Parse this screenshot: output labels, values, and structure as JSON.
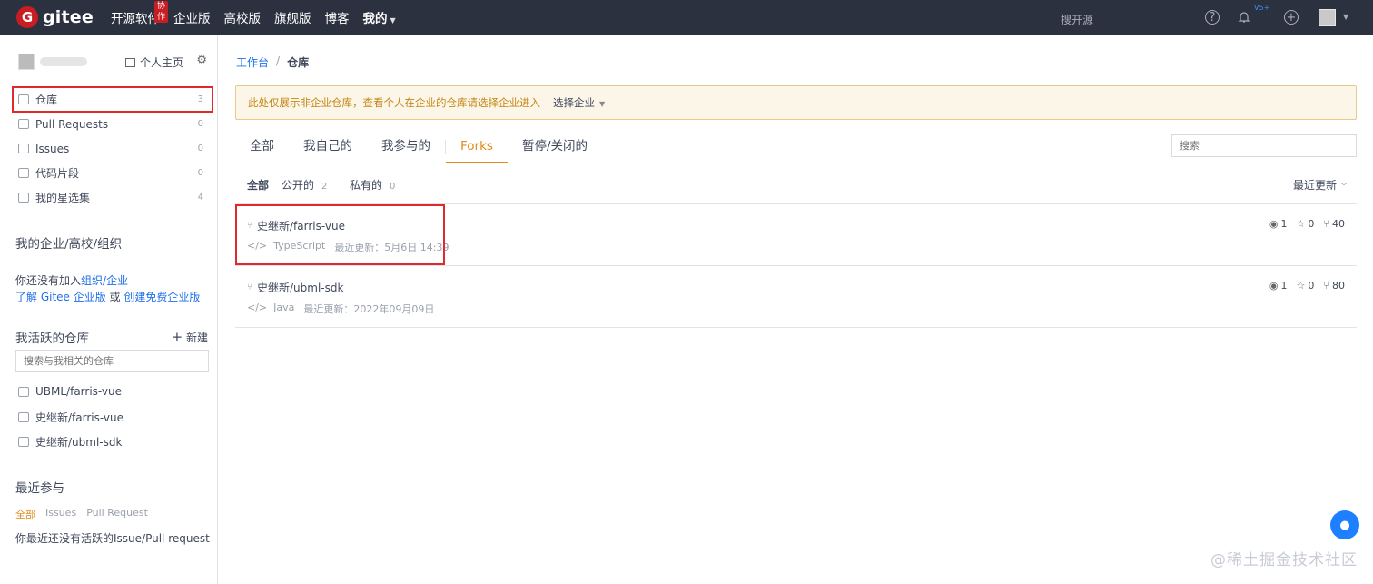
{
  "topnav": {
    "brand": "gitee",
    "logo_letter": "G",
    "items": [
      {
        "label": "开源软件",
        "badge": "协作"
      },
      {
        "label": "企业版"
      },
      {
        "label": "高校版"
      },
      {
        "label": "旗舰版"
      },
      {
        "label": "博客"
      },
      {
        "label": "我的"
      }
    ],
    "search_label": "搜开源",
    "vip_label": "V5+",
    "icons": [
      "help-icon",
      "bell-icon",
      "plus-icon",
      "avatar"
    ]
  },
  "sidebar": {
    "home_label": "个人主页",
    "menu": [
      {
        "label": "仓库",
        "count": "3",
        "icon": "repo-icon"
      },
      {
        "label": "Pull Requests",
        "count": "0",
        "icon": "pull-request-icon"
      },
      {
        "label": "Issues",
        "count": "0",
        "icon": "issues-icon"
      },
      {
        "label": "代码片段",
        "count": "0",
        "icon": "code-icon"
      },
      {
        "label": "我的星选集",
        "count": "4",
        "icon": "star-collection-icon"
      }
    ],
    "org_title": "我的企业/高校/组织",
    "org_text_prefix": "你还没有加入",
    "org_link1": "组织",
    "org_slash": "/",
    "org_link2": "企业",
    "learn_link": "了解 Gitee 企业版",
    "or_text": " 或 ",
    "create_link": "创建免费企业版",
    "active_title": "我活跃的仓库",
    "new_label": "新建",
    "active_search_placeholder": "搜索与我相关的仓库",
    "active_repos": [
      "UBML/farris-vue",
      "史继新/farris-vue",
      "史继新/ubml-sdk"
    ],
    "recent_title": "最近参与",
    "recent_tabs": [
      "全部",
      "Issues",
      "Pull Request"
    ],
    "recent_empty": "你最近还没有活跃的Issue/Pull request"
  },
  "main": {
    "breadcrumb": [
      "工作台",
      "仓库"
    ],
    "notice": "此处仅展示非企业仓库，查看个人在企业的仓库请选择企业进入",
    "notice_select": "选择企业",
    "tabs": [
      "全部",
      "我自己的",
      "我参与的",
      "Forks",
      "暂停/关闭的"
    ],
    "active_tab": "Forks",
    "search_placeholder": "搜索",
    "filters": [
      {
        "label": "全部",
        "count": ""
      },
      {
        "label": "公开的",
        "count": "2"
      },
      {
        "label": "私有的",
        "count": "0"
      }
    ],
    "sort_label": "最近更新",
    "repos": [
      {
        "name": "史继新/farris-vue",
        "lang": "TypeScript",
        "updated": "最近更新：5月6日 14:39",
        "watch": "1",
        "star": "0",
        "fork": "40"
      },
      {
        "name": "史继新/ubml-sdk",
        "lang": "Java",
        "updated": "最近更新：2022年09月09日",
        "watch": "1",
        "star": "0",
        "fork": "80"
      }
    ]
  },
  "watermark": "@稀土掘金技术社区"
}
